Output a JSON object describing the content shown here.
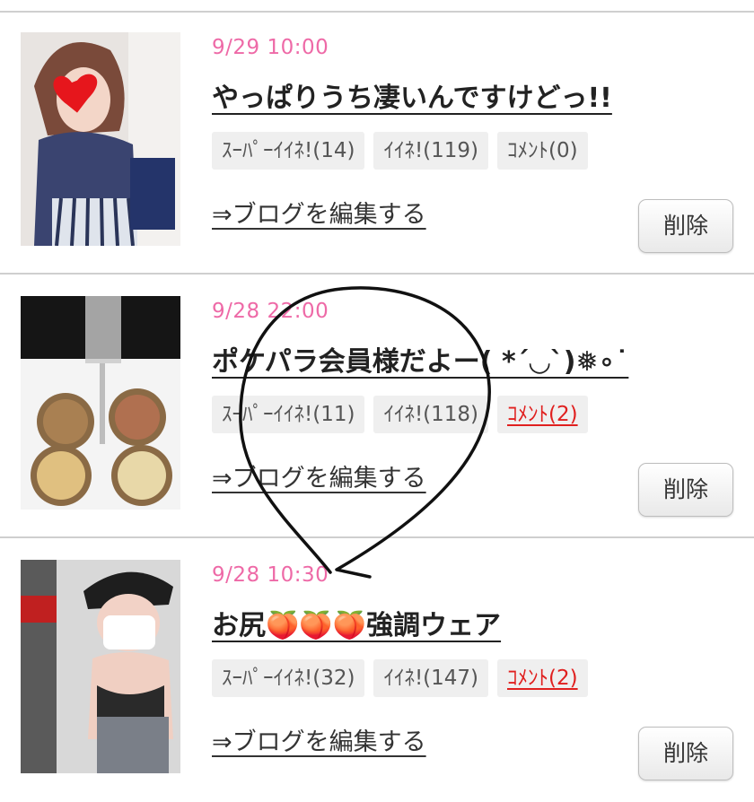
{
  "posts": [
    {
      "date": "9/29 10:00",
      "title": "やっぱりうち凄いんですけどっ!!",
      "super_like": "ｽｰﾊﾟｰｲｲﾈ!(14)",
      "like": "ｲｲﾈ!(119)",
      "comment": "ｺﾒﾝﾄ(0)",
      "edit_link": "⇒ブログを編集する",
      "delete_label": "削除"
    },
    {
      "date": "9/28 22:00",
      "title": "ポケパラ会員様だよー( *´◡`)❅∘˙",
      "super_like": "ｽｰﾊﾟｰｲｲﾈ!(11)",
      "like": "ｲｲﾈ!(118)",
      "comment": "ｺﾒﾝﾄ(2)",
      "edit_link": "⇒ブログを編集する",
      "delete_label": "削除"
    },
    {
      "date": "9/28 10:30",
      "title": "お尻🍑🍑🍑強調ウェア",
      "super_like": "ｽｰﾊﾟｰｲｲﾈ!(32)",
      "like": "ｲｲﾈ!(147)",
      "comment": "ｺﾒﾝﾄ(2)",
      "edit_link": "⇒ブログを編集する",
      "delete_label": "削除"
    }
  ],
  "colors": {
    "date": "#ee6aa7",
    "comment_active": "#e0201f",
    "chip_bg": "#efefef",
    "divider": "#cfcfcf"
  }
}
